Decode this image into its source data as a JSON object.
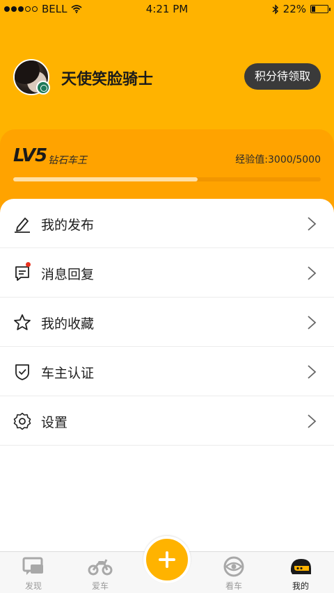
{
  "status_bar": {
    "carrier": "BELL",
    "time": "4:21 PM",
    "battery": "22%",
    "battery_level": 0.22
  },
  "profile": {
    "username": "天使笑脸骑士",
    "points_button": "积分待领取"
  },
  "level": {
    "tag": "LV5",
    "name": "钻石车王",
    "exp_text": "经验值:3000/5000",
    "exp_progress": 0.6
  },
  "menu": {
    "items": [
      {
        "label": "我的发布",
        "icon": "pen-icon"
      },
      {
        "label": "消息回复",
        "icon": "message-icon"
      },
      {
        "label": "我的收藏",
        "icon": "star-icon"
      },
      {
        "label": "车主认证",
        "icon": "shield-check-icon"
      },
      {
        "label": "设置",
        "icon": "gear-icon"
      }
    ]
  },
  "tab_bar": {
    "tabs": [
      {
        "label": "发现",
        "icon": "discover-icon",
        "active": false
      },
      {
        "label": "爱车",
        "icon": "motorcycle-icon",
        "active": false
      },
      {
        "label": "",
        "icon": "plus-icon",
        "active": false
      },
      {
        "label": "看车",
        "icon": "eye-icon",
        "active": false
      },
      {
        "label": "我的",
        "icon": "helmet-icon",
        "active": true
      }
    ]
  },
  "colors": {
    "brand_yellow": "#FFB300",
    "card_orange": "#FFA300",
    "dark_button": "#3a3a3a",
    "notification_red": "#e8311f"
  }
}
